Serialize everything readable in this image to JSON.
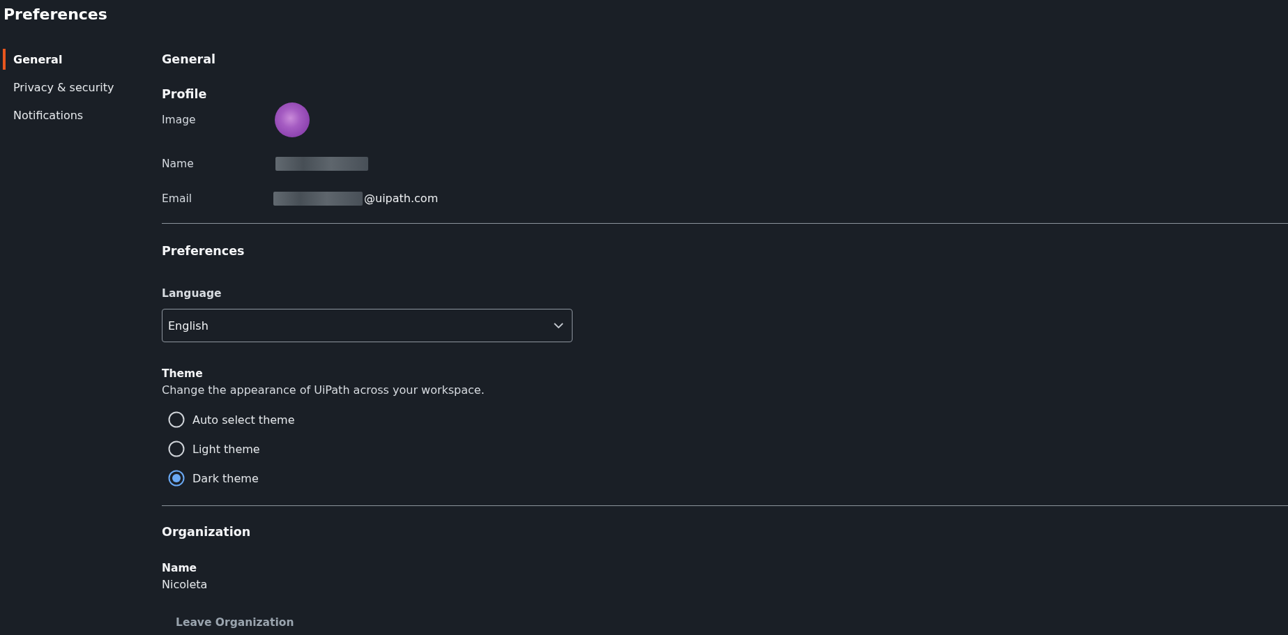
{
  "page": {
    "title": "Preferences"
  },
  "sidebar": {
    "items": [
      {
        "label": "General",
        "selected": true
      },
      {
        "label": "Privacy & security",
        "selected": false
      },
      {
        "label": "Notifications",
        "selected": false
      }
    ]
  },
  "content": {
    "heading": "General",
    "profile": {
      "heading": "Profile",
      "fields": [
        {
          "label": "Image",
          "kind": "avatar"
        },
        {
          "label": "Name",
          "kind": "redacted"
        },
        {
          "label": "Email",
          "kind": "email",
          "value": "@uipath.com"
        }
      ]
    },
    "preferences": {
      "heading": "Preferences",
      "language": {
        "label": "Language",
        "value": "English"
      },
      "theme": {
        "label": "Theme",
        "description": "Change the appearance of UiPath across your workspace.",
        "options": [
          {
            "label": "Auto select theme",
            "selected": false
          },
          {
            "label": "Light theme",
            "selected": false
          },
          {
            "label": "Dark theme",
            "selected": true
          }
        ]
      }
    },
    "organization": {
      "heading": "Organization",
      "name_label": "Name",
      "name_value": "Nicoleta",
      "button": "Leave Organization"
    }
  }
}
